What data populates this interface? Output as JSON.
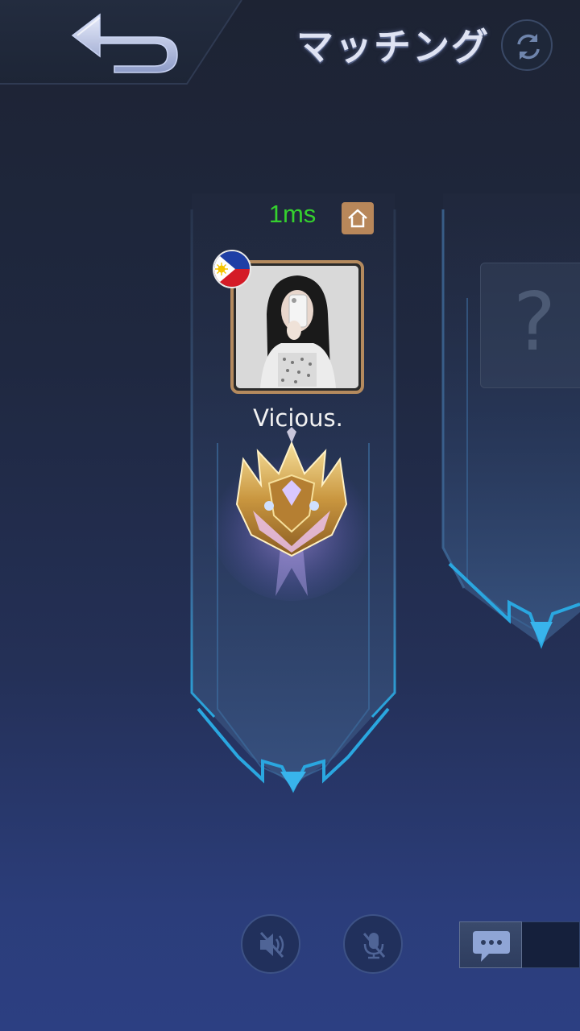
{
  "header": {
    "title": "マッチング",
    "back_icon": "back-arrow-icon",
    "refresh_icon": "refresh-icon"
  },
  "player_slot": {
    "ping": "1ms",
    "home_icon": "home-icon",
    "flag": "philippines-flag-icon",
    "name": "Vicious.",
    "rank_icon": "rank-emblem-icon"
  },
  "empty_slot": {
    "placeholder": "?"
  },
  "controls": {
    "speaker_icon": "speaker-muted-icon",
    "mic_icon": "mic-muted-icon",
    "chat_icon": "chat-bubble-icon"
  },
  "colors": {
    "ping": "#35d12e",
    "home_badge": "#b8875a",
    "frame": "#b48a5e",
    "banner_glow": "#29a8e0"
  }
}
